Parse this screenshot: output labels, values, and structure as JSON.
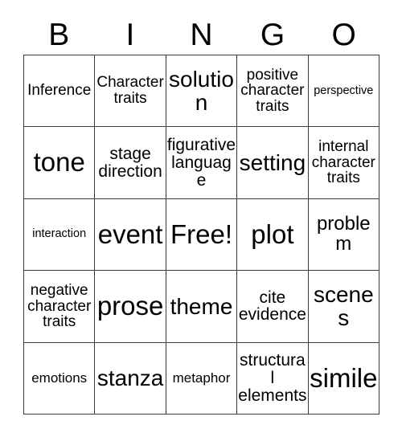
{
  "card": {
    "header_letters": [
      "B",
      "I",
      "N",
      "G",
      "O"
    ],
    "rows": [
      [
        {
          "text": "Inference",
          "size": "md"
        },
        {
          "text": "Character traits",
          "size": "md"
        },
        {
          "text": "solution",
          "size": "xxl"
        },
        {
          "text": "positive character traits",
          "size": "md"
        },
        {
          "text": "perspective",
          "size": "xs"
        }
      ],
      [
        {
          "text": "tone",
          "size": "huge"
        },
        {
          "text": "stage direction",
          "size": "lg"
        },
        {
          "text": "figurative language",
          "size": "lg"
        },
        {
          "text": "setting",
          "size": "xxl"
        },
        {
          "text": "internal character traits",
          "size": "md"
        }
      ],
      [
        {
          "text": "interaction",
          "size": "xs"
        },
        {
          "text": "event",
          "size": "huge"
        },
        {
          "text": "Free!",
          "size": "huge"
        },
        {
          "text": "plot",
          "size": "huge"
        },
        {
          "text": "problem",
          "size": "xl"
        }
      ],
      [
        {
          "text": "negative character traits",
          "size": "md"
        },
        {
          "text": "prose",
          "size": "huge"
        },
        {
          "text": "theme",
          "size": "xxl"
        },
        {
          "text": "cite evidence",
          "size": "lg"
        },
        {
          "text": "scenes",
          "size": "xxl"
        }
      ],
      [
        {
          "text": "emotions",
          "size": "sm"
        },
        {
          "text": "stanza",
          "size": "xxl"
        },
        {
          "text": "metaphor",
          "size": "sm"
        },
        {
          "text": "structural elements",
          "size": "lg"
        },
        {
          "text": "simile",
          "size": "huge"
        }
      ]
    ]
  },
  "colors": {
    "background": "#ffffff",
    "text": "#000000",
    "grid_line": "#3a3a3a"
  }
}
